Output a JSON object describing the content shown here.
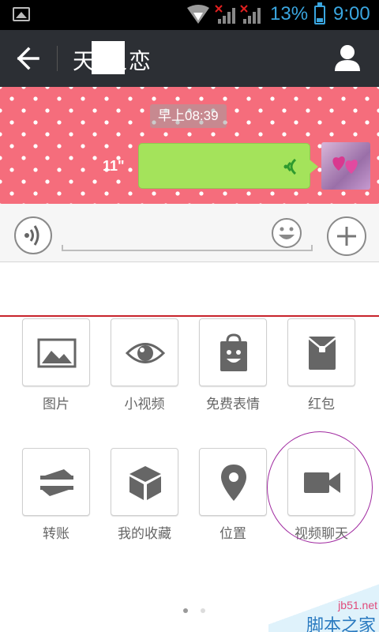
{
  "status_bar": {
    "battery_percent": "13%",
    "time": "9:00",
    "icons": [
      "image-notification-icon",
      "wifi-icon",
      "signal-no-sim-icon",
      "signal-no-sim-icon",
      "battery-icon"
    ]
  },
  "title_bar": {
    "title": "天 之恋",
    "icons": [
      "back-arrow-icon",
      "profile-icon"
    ]
  },
  "chat": {
    "timestamp": "早上08:39",
    "voice_message": {
      "duration": "11\"",
      "icon": "voice-wave-icon"
    },
    "avatar_icon": "avatar-image"
  },
  "input_bar": {
    "text_value": "",
    "icons": [
      "voice-input-icon",
      "emoji-icon",
      "plus-icon"
    ]
  },
  "panel": {
    "items": [
      {
        "label": "图片",
        "icon": "image-icon"
      },
      {
        "label": "小视频",
        "icon": "eye-icon"
      },
      {
        "label": "免费表情",
        "icon": "sticker-bag-icon"
      },
      {
        "label": "红包",
        "icon": "red-packet-icon"
      },
      {
        "label": "转账",
        "icon": "transfer-icon"
      },
      {
        "label": "我的收藏",
        "icon": "favorites-cube-icon"
      },
      {
        "label": "位置",
        "icon": "location-pin-icon"
      },
      {
        "label": "视频聊天",
        "icon": "video-camera-icon"
      }
    ],
    "page_indicator": {
      "pages": 2,
      "current": 1
    }
  },
  "watermark": {
    "domain": "jb51.net",
    "name": "脚本之家"
  },
  "colors": {
    "status_text": "#3aa6e0",
    "title_bar_bg": "#2c2f34",
    "chat_bg": "#f56d7c",
    "voice_bubble": "#a4e35b",
    "divider_red": "#c8232c",
    "highlight_circle": "#a02aa0"
  }
}
